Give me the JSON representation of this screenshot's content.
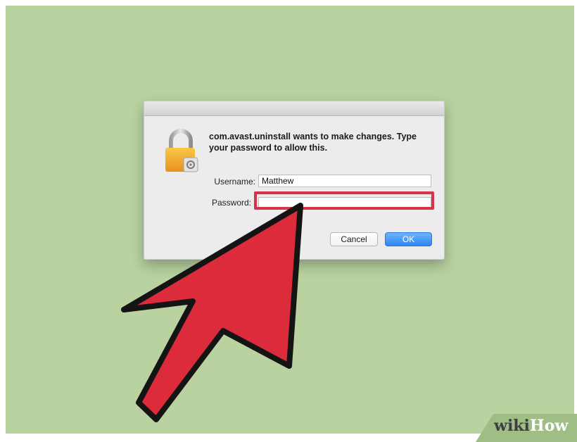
{
  "dialog": {
    "message": "com.avast.uninstall wants to make changes. Type your password to allow this.",
    "username_label": "Username:",
    "username_value": "Matthew",
    "password_label": "Password:",
    "password_value": "",
    "cancel_label": "Cancel",
    "ok_label": "OK",
    "icon": "lock-icon"
  },
  "annotation": {
    "pointer": "arrow-pointer-icon",
    "highlight_color": "#d5334a",
    "arrow_color": "#dc2c3c"
  },
  "watermark": {
    "wiki": "wiki",
    "how": "How"
  }
}
